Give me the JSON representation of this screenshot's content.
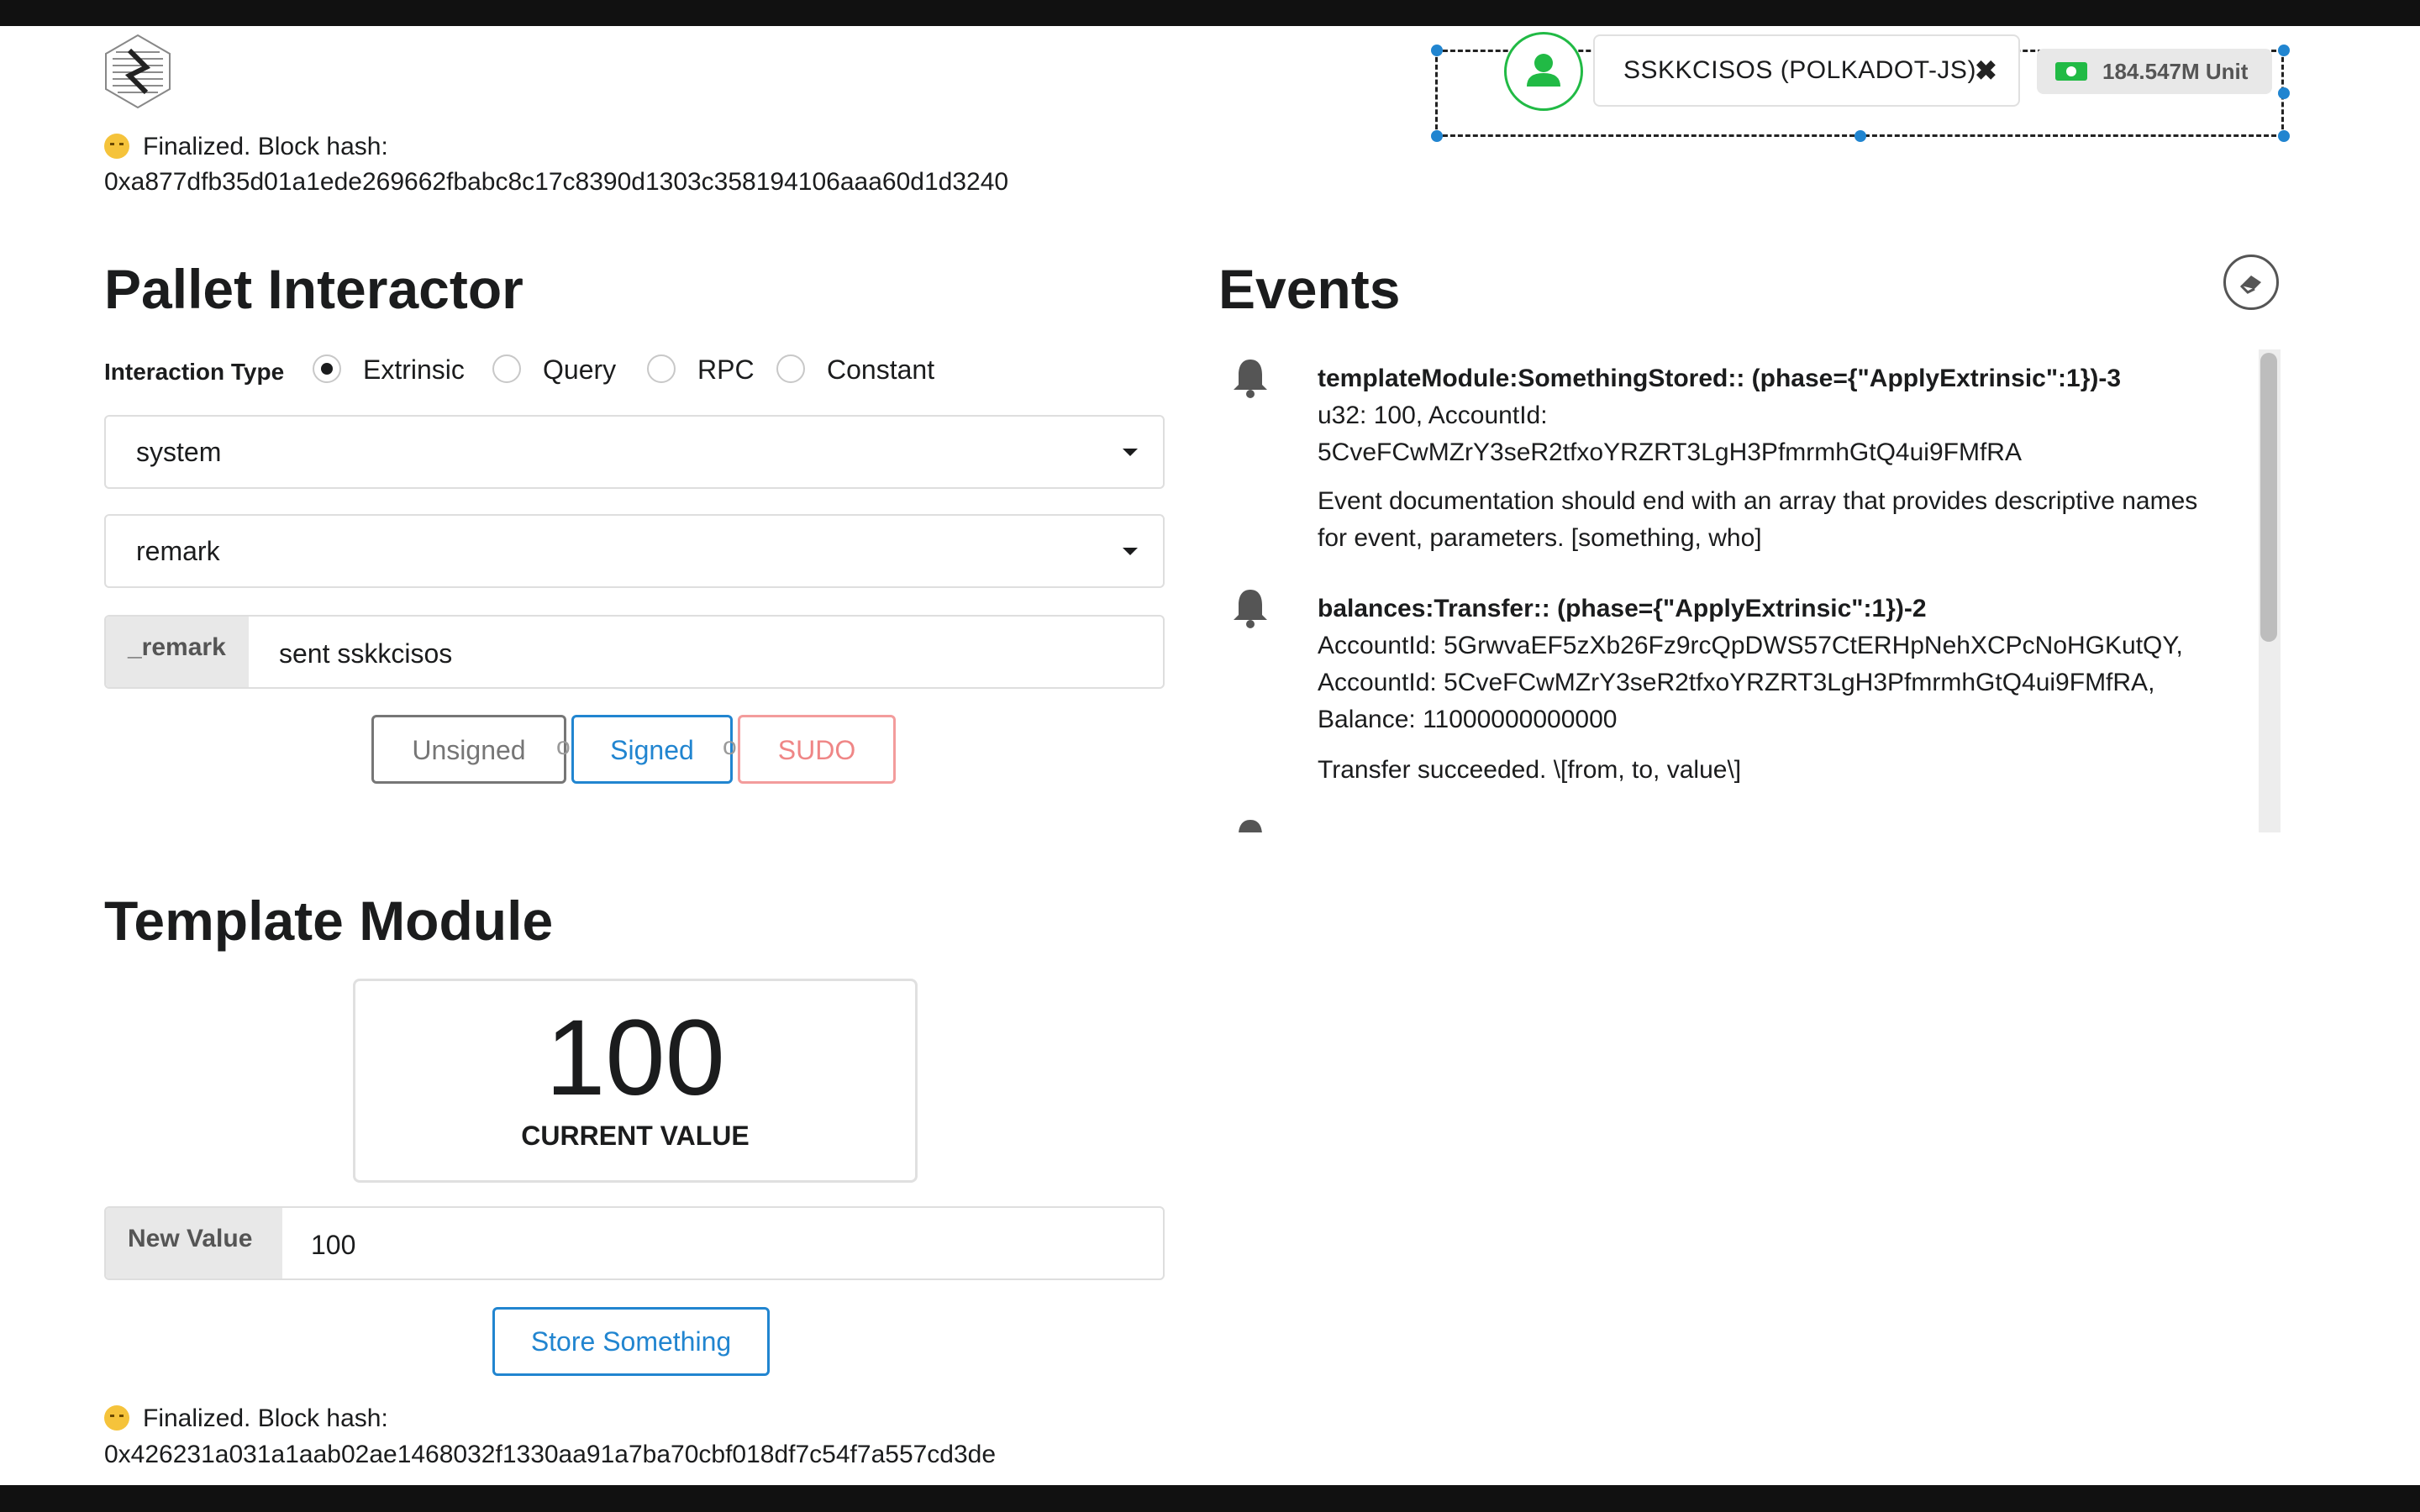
{
  "header": {
    "account_label": "SSKKCISOS (POLKADOT-JS)",
    "balance": "184.547M Unit"
  },
  "status_top": {
    "label": "Finalized. Block hash:",
    "hash": "0xa877dfb35d01a1ede269662fbabc8c17c8390d1303c358194106aaa60d1d3240"
  },
  "pallet_interactor": {
    "title": "Pallet Interactor",
    "interaction_type_label": "Interaction Type",
    "options": [
      "Extrinsic",
      "Query",
      "RPC",
      "Constant"
    ],
    "selected": "Extrinsic",
    "pallet_value": "system",
    "callable_value": "remark",
    "param_label": "_remark",
    "param_value": "sent sskkcisos",
    "buttons": {
      "unsigned": "Unsigned",
      "signed": "Signed",
      "sudo": "SUDO",
      "or": "or"
    }
  },
  "events": {
    "title": "Events",
    "items": [
      {
        "title": "templateModule:SomethingStored:: (phase={\"ApplyExtrinsic\":1})-3",
        "lines": [
          "u32: 100, AccountId:",
          "5CveFCwMZrY3seR2tfxoYRZRT3LgH3PfmrmhGtQ4ui9FMfRA"
        ],
        "doc": [
          "Event documentation should end with an array that provides descriptive names",
          "for event, parameters. [something, who]"
        ]
      },
      {
        "title": "balances:Transfer:: (phase={\"ApplyExtrinsic\":1})-2",
        "lines": [
          "AccountId: 5GrwvaEF5zXb26Fz9rcQpDWS57CtERHpNehXCPcNoHGKutQY,",
          "AccountId: 5CveFCwMZrY3seR2tfxoYRZRT3LgH3PfmrmhGtQ4ui9FMfRA,",
          "Balance: 11000000000000"
        ],
        "doc": [
          "Transfer succeeded. \\[from, to, value\\]"
        ]
      }
    ]
  },
  "template_module": {
    "title": "Template Module",
    "current_value": "100",
    "current_value_label": "CURRENT VALUE",
    "new_value_label": "New Value",
    "new_value": "100",
    "store_button": "Store Something"
  },
  "status_bottom": {
    "label": "Finalized. Block hash:",
    "hash": "0x426231a031a1aab02ae1468032f1330aa91a7ba70cbf018df7c54f7a557cd3de"
  },
  "colors": {
    "accent": "#2185d0",
    "success": "#21ba45",
    "danger": "#ef8686"
  }
}
